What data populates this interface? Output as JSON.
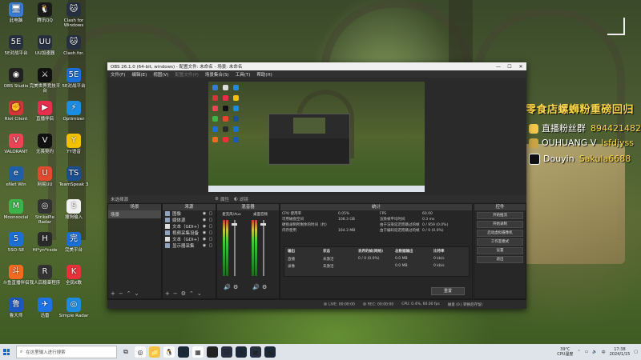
{
  "desktop": {
    "icons": [
      {
        "label": "此电脑",
        "icon": "computer-icon",
        "color": "#3a7bd5",
        "glyph": "🖥"
      },
      {
        "label": "腾讯QQ",
        "icon": "qq-icon",
        "color": "#1a1a1a",
        "glyph": "🐧"
      },
      {
        "label": "Clash for Windows",
        "icon": "clash-icon",
        "color": "#263040",
        "glyph": "🐱"
      },
      {
        "label": "5E对战平台",
        "icon": "5e-icon",
        "color": "#263040",
        "glyph": "5E"
      },
      {
        "label": "UU加速器",
        "icon": "uu-icon",
        "color": "#263040",
        "glyph": "UU"
      },
      {
        "label": "Clash.for.",
        "icon": "clash-folder-icon",
        "color": "#263040",
        "glyph": "🐱"
      },
      {
        "label": "OBS Studio",
        "icon": "obs-icon",
        "color": "#222",
        "glyph": "◉"
      },
      {
        "label": "完美世界竞技平台",
        "icon": "perfect-world-icon",
        "color": "#111",
        "glyph": "⚔"
      },
      {
        "label": "5E对战平台",
        "icon": "5e-platform-icon",
        "color": "#1b6fd8",
        "glyph": "5E"
      },
      {
        "label": "Riot Client",
        "icon": "riot-icon",
        "color": "#d13639",
        "glyph": "✊"
      },
      {
        "label": "直播伴侣",
        "icon": "live-companion-icon",
        "color": "#e62e4d",
        "glyph": "▶"
      },
      {
        "label": "Optimizer",
        "icon": "optimizer-icon",
        "color": "#1d8ce0",
        "glyph": "⚡"
      },
      {
        "label": "VALORANT",
        "icon": "valorant-icon",
        "color": "#e94556",
        "glyph": "V"
      },
      {
        "label": "无畏契约",
        "icon": "wuwei-icon",
        "color": "#111",
        "glyph": "V"
      },
      {
        "label": "YY语音",
        "icon": "yy-icon",
        "color": "#f2c200",
        "glyph": "Y"
      },
      {
        "label": "eNet Win",
        "icon": "enet-icon",
        "color": "#1f5ea8",
        "glyph": "e"
      },
      {
        "label": "网易UU",
        "icon": "netease-uu-icon",
        "color": "#e04a2f",
        "glyph": "U"
      },
      {
        "label": "TeamSpeak 3",
        "icon": "teamspeak-icon",
        "color": "#1b4f8f",
        "glyph": "TS"
      },
      {
        "label": "Moonsocial",
        "icon": "moon-icon",
        "color": "#3bb54a",
        "glyph": "M"
      },
      {
        "label": "StrikePie Radar",
        "icon": "strikepie-icon",
        "color": "#333",
        "glyph": "◎"
      },
      {
        "label": "搜狗输入",
        "icon": "sogou-icon",
        "color": "#f0f0f0",
        "glyph": "S"
      },
      {
        "label": "5SO-SE",
        "icon": "5so-icon",
        "color": "#1d6fd6",
        "glyph": "5"
      },
      {
        "label": "Hi*yn*csde",
        "icon": "hiyn-icon",
        "color": "#2a2a2a",
        "glyph": "H"
      },
      {
        "label": "完美平台",
        "icon": "perfect-platform-icon",
        "color": "#1b6fd8",
        "glyph": "完"
      },
      {
        "label": "斗鱼直播伴侣",
        "icon": "douyu-icon",
        "color": "#f26a1f",
        "glyph": "斗"
      },
      {
        "label": "我人后稳奋程序",
        "icon": "program-icon",
        "color": "#333",
        "glyph": "R"
      },
      {
        "label": "全民K歌",
        "icon": "kge-icon",
        "color": "#e8313a",
        "glyph": "K"
      },
      {
        "label": "鲁大师",
        "icon": "ludashi-icon",
        "color": "#1c58c4",
        "glyph": "鲁"
      },
      {
        "label": "迅雷",
        "icon": "xunlei-icon",
        "color": "#1d73e6",
        "glyph": "✈"
      },
      {
        "label": "Simple Radar",
        "icon": "simple-radar-icon",
        "color": "#1d8ce0",
        "glyph": "◎"
      }
    ]
  },
  "overlay": {
    "title": "零食店螺蛳粉重磅回归",
    "rows": [
      {
        "label": "直播粉丝群",
        "value": "894421482",
        "icon": "fan-group-icon"
      },
      {
        "label": "OUHUANG V",
        "value": "lsfdjyss",
        "icon": "wechat-icon"
      },
      {
        "label": "Douyin",
        "value": "Sakula6688",
        "icon": "douyin-icon"
      }
    ]
  },
  "obs": {
    "title": "OBS 26.1.0 (64-bit, windows) - 配置文件: 未命名 - 场景: 未命名",
    "window_controls": [
      "—",
      "☐",
      "✕"
    ],
    "menu": [
      "文件(F)",
      "编辑(E)",
      "视图(V)",
      "配置文件(P)",
      "场景集合(S)",
      "工具(T)",
      "帮助(H)"
    ],
    "menu_disabled": [
      false,
      false,
      false,
      true,
      false,
      false,
      false
    ],
    "bar": {
      "no_source": "未选择源",
      "properties": "属性",
      "filters": "滤镜"
    },
    "docks": {
      "scenes": {
        "title": "场景",
        "items": [
          "场景"
        ]
      },
      "sources": {
        "title": "来源",
        "items": [
          {
            "label": "图像"
          },
          {
            "label": "媒体源"
          },
          {
            "label": "文本（GDI+）"
          },
          {
            "label": "视频采集设备"
          },
          {
            "label": "文本（GDI+）"
          },
          {
            "label": "显示器采集"
          }
        ]
      },
      "mixer": {
        "title": "混音器",
        "channels": [
          "麦克风/Aux",
          "桌面音频"
        ]
      },
      "stats": {
        "title": "统计",
        "left": [
          [
            "CPU 使用率",
            "0.05%"
          ],
          [
            "可用磁盘空间",
            "108.3 GB"
          ],
          [
            "硬盘录制所剩余的时间（约）",
            "—"
          ],
          [
            "内存使用",
            "164.3 MB"
          ]
        ],
        "right": [
          [
            "FPS",
            "60.00"
          ],
          [
            "渲染帧平均时间",
            "0.3 ms"
          ],
          [
            "由于渲染延迟而跳过的帧",
            "0 / 959 (0.0%)"
          ],
          [
            "由于编码延迟而跳过的帧",
            "0 / 0 (0.0%)"
          ]
        ],
        "table_headers": [
          "输出",
          "状态",
          "丢弃的帧(网络)",
          "总数据输出",
          "比特率"
        ],
        "table_rows": [
          [
            "直播",
            "未激活",
            "0 / 0 (0.0%)",
            "0.0 MB",
            "0 kb/s"
          ],
          [
            "录像",
            "未激活",
            "",
            "0.0 MB",
            "0 kb/s"
          ]
        ],
        "reset": "重置"
      },
      "controls": {
        "title": "控件",
        "buttons": [
          "开始推流",
          "开始录制",
          "启动虚拟摄像机",
          "工作室模式",
          "设置",
          "退出"
        ]
      }
    },
    "status": {
      "live": "LIVE: 00:00:00",
      "rec": "REC: 00:00:00",
      "cpu": "CPU: 0.4%, 60.00 fps",
      "disk": "磁盘 (0 | 转换后存留)"
    }
  },
  "taskbar": {
    "search_placeholder": "在这里输入进行搜索",
    "apps": [
      {
        "icon": "task-view-icon",
        "color": "#dfe4ea",
        "glyph": "⧉"
      },
      {
        "icon": "chrome-icon",
        "color": "#fff",
        "glyph": "◎"
      },
      {
        "icon": "explorer-icon",
        "color": "#f5c242",
        "glyph": "📁"
      },
      {
        "icon": "qq-taskbar-icon",
        "color": "#fff",
        "glyph": "🐧"
      },
      {
        "icon": "steam-icon",
        "color": "#1b2838",
        "glyph": "S"
      },
      {
        "icon": "store-icon",
        "color": "#fff",
        "glyph": "▦"
      },
      {
        "icon": "obs-taskbar-icon",
        "color": "#222",
        "glyph": "◉"
      },
      {
        "icon": "clash-taskbar-icon",
        "color": "#263040",
        "glyph": "🐱"
      },
      {
        "icon": "steam2-icon",
        "color": "#1b2838",
        "glyph": "S"
      },
      {
        "icon": "app-icon",
        "color": "#263040",
        "glyph": "▣"
      },
      {
        "icon": "game-icon",
        "color": "#1b2838",
        "glyph": "◆"
      }
    ],
    "weather": "39°C",
    "weather_label": "CPU温度",
    "time": "17:38",
    "date": "2024/1/15"
  }
}
